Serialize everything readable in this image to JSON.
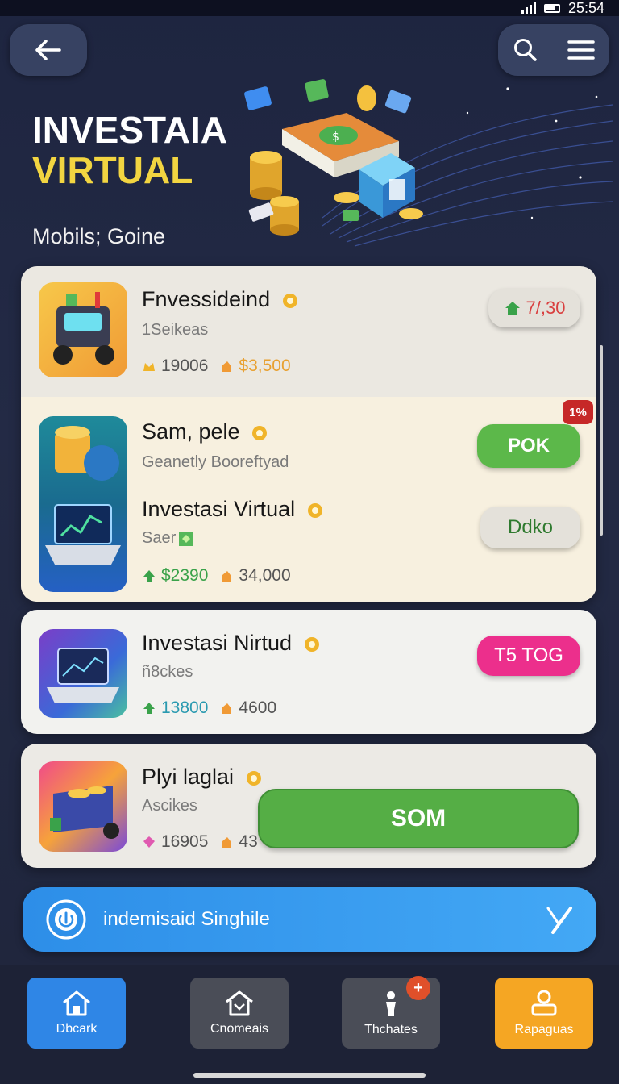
{
  "status": {
    "time": "25:54"
  },
  "header": {
    "back_icon": "arrow-left-icon",
    "search_icon": "search-icon",
    "menu_icon": "hamburger-menu-icon"
  },
  "hero": {
    "title_line1": "INVESTAIA",
    "title_line2": "VIRTUAL",
    "subtitle": "Mobils; Goine",
    "colors": {
      "title_white": "#ffffff",
      "title_yellow": "#f2d541"
    }
  },
  "cards": [
    {
      "title": "Fnvessideind",
      "subtitle": "1Seikeas",
      "stat1": "19006",
      "stat2": "$3,500",
      "action": "7/,30"
    },
    {
      "title": "Sam, pele",
      "subtitle": "Geanetly Booreftyad",
      "action": "POK",
      "badge": "1%"
    },
    {
      "title": "Investasi Virtual",
      "subtitle": "Saer",
      "stat1": "$2390",
      "stat2": "34,000",
      "action": "Ddko"
    },
    {
      "title": "Investasi Nirtud",
      "subtitle": "ñ8ckes",
      "stat1": "13800",
      "stat2": "4600",
      "action": "T5 TOG"
    },
    {
      "title": "Plyi laglai",
      "subtitle": "Ascikes",
      "stat1": "16905",
      "stat2": "43",
      "action": "SOM"
    }
  ],
  "banner": {
    "text": "indemisaid Singhile"
  },
  "bottom_nav": [
    {
      "label": "Dbcark",
      "icon": "home-icon",
      "color": "#2f86e6"
    },
    {
      "label": "Cnomeais",
      "icon": "house-outline-icon",
      "color": "#4a4d57"
    },
    {
      "label": "Thchates",
      "icon": "person-icon",
      "color": "#4a4d57",
      "badge": "+"
    },
    {
      "label": "Rapaguas",
      "icon": "profile-card-icon",
      "color": "#f5a623"
    }
  ]
}
